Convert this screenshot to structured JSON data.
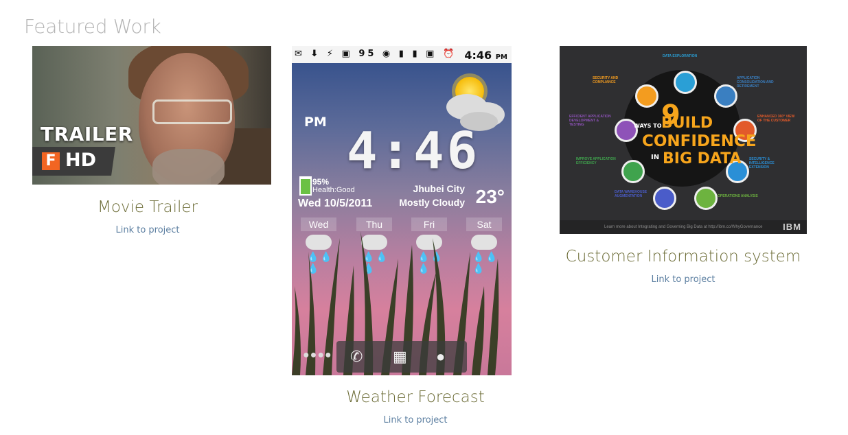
{
  "section": {
    "title": "Featured Work"
  },
  "projects": [
    {
      "title": "Movie Trailer",
      "link_label": "Link to project",
      "thumb": {
        "overlay_text": "TRAILER",
        "badge_letter": "F",
        "badge_text": "HD",
        "badge_color": "#f26522"
      }
    },
    {
      "title": "Weather Forecast",
      "link_label": "Link to project",
      "thumb": {
        "status_time": "4:46",
        "status_ampm": "PM",
        "status_level": "95",
        "ampm": "PM",
        "clock": "4:46",
        "battery": "95%",
        "health": "Health:Good",
        "date": "Wed 10/5/2011",
        "city": "Jhubei City",
        "condition": "Mostly Cloudy",
        "temperature": "23°",
        "days": [
          "Wed",
          "Thu",
          "Fri",
          "Sat"
        ]
      }
    },
    {
      "title": "Customer Information system",
      "link_label": "Link to project",
      "thumb": {
        "number": "9",
        "line1a": "WAYS TO",
        "line1b": "BUILD",
        "line2": "CONFIDENCE",
        "line3a": "IN",
        "line3b": "BIG DATA",
        "footer": "Learn more about Integrating and Governing Big Data at http://ibm.co/WhyGovernance",
        "brand": "IBM",
        "topics": [
          "DATA EXPLORATION",
          "APPLICATION CONSOLIDATION AND RETIREMENT",
          "ENHANCED 360° VIEW OF THE CUSTOMER",
          "SECURITY & INTELLIGENCE EXTENSION",
          "OPERATIONS ANALYSIS",
          "DATA WAREHOUSE AUGMENTATION",
          "IMPROVE APPLICATION EFFICIENCY",
          "EFFICIENT APPLICATION DEVELOPMENT & TESTING",
          "SECURITY AND COMPLIANCE"
        ]
      }
    }
  ],
  "colors": {
    "title": "#b3b3b3",
    "card_title": "#6b6b35",
    "link": "#5c7fa1",
    "accent_orange": "#f7a51c"
  }
}
